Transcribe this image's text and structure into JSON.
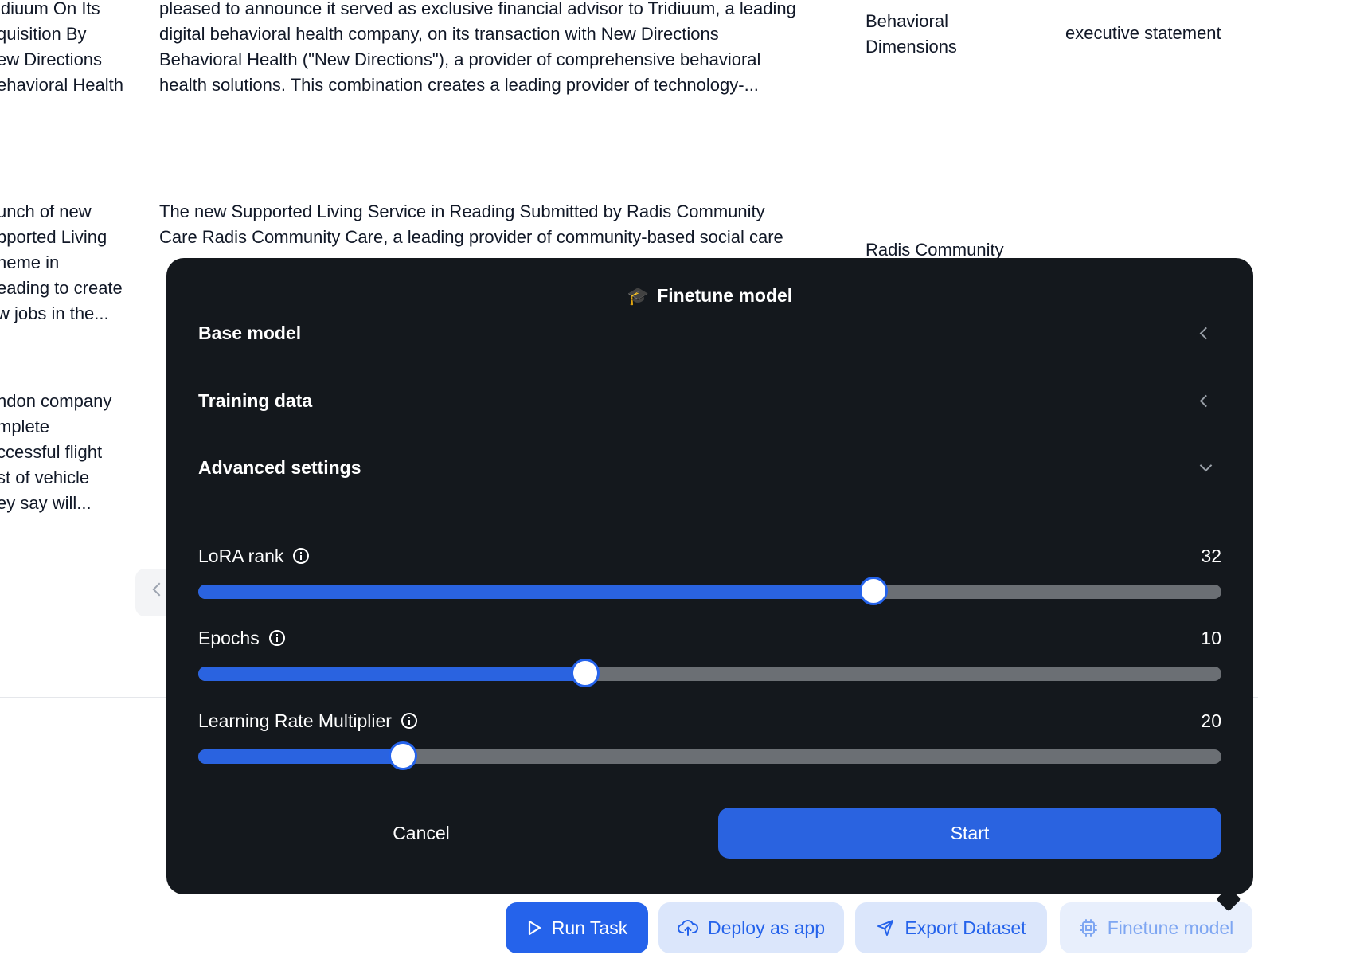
{
  "table": {
    "row1": {
      "col1": [
        "idiuum On Its",
        "quisition By",
        "ew Directions",
        "ehavioral Health"
      ],
      "col2": [
        "pleased to announce it served as exclusive financial advisor to Tridiuum, a leading",
        "digital behavioral health company, on its transaction with New Directions",
        "Behavioral Health (\"New Directions\"), a provider of comprehensive behavioral",
        "health solutions. This combination creates a leading provider of technology-..."
      ],
      "col3": [
        "Behavioral",
        "Dimensions"
      ],
      "col4": [
        "executive statement"
      ]
    },
    "row2": {
      "col1": [
        "unch of new",
        "pported Living",
        "heme in",
        "eading to create",
        "w jobs in the..."
      ],
      "col2": [
        "The new Supported Living Service in Reading Submitted by Radis Community",
        "Care Radis Community Care, a leading provider of community-based social care"
      ],
      "col3": [
        "Radis Community"
      ]
    },
    "row3": {
      "col1": [
        "ndon company",
        "mplete",
        "ccessful flight",
        "st of vehicle",
        "ey say will..."
      ]
    }
  },
  "modal": {
    "icon": "graduation-cap-icon",
    "title": "Finetune model",
    "sections": {
      "base_model": "Base model",
      "training_data": "Training data",
      "advanced_settings": "Advanced settings"
    },
    "sliders": {
      "lora_rank": {
        "label": "LoRA rank",
        "value": "32",
        "fill_fraction": 0.66
      },
      "epochs": {
        "label": "Epochs",
        "value": "10",
        "fill_fraction": 0.378
      },
      "lr_multiplier": {
        "label": "Learning Rate Multiplier",
        "value": "20",
        "fill_fraction": 0.2
      }
    },
    "cancel_label": "Cancel",
    "start_label": "Start"
  },
  "actions": {
    "run_task": "Run Task",
    "deploy": "Deploy as app",
    "export": "Export Dataset",
    "finetune": "Finetune model"
  },
  "colors": {
    "primary": "#2563eb",
    "modal_bg": "#14181d",
    "track": "#6b6f74",
    "secondary_btn_bg": "#dbe6fb"
  }
}
